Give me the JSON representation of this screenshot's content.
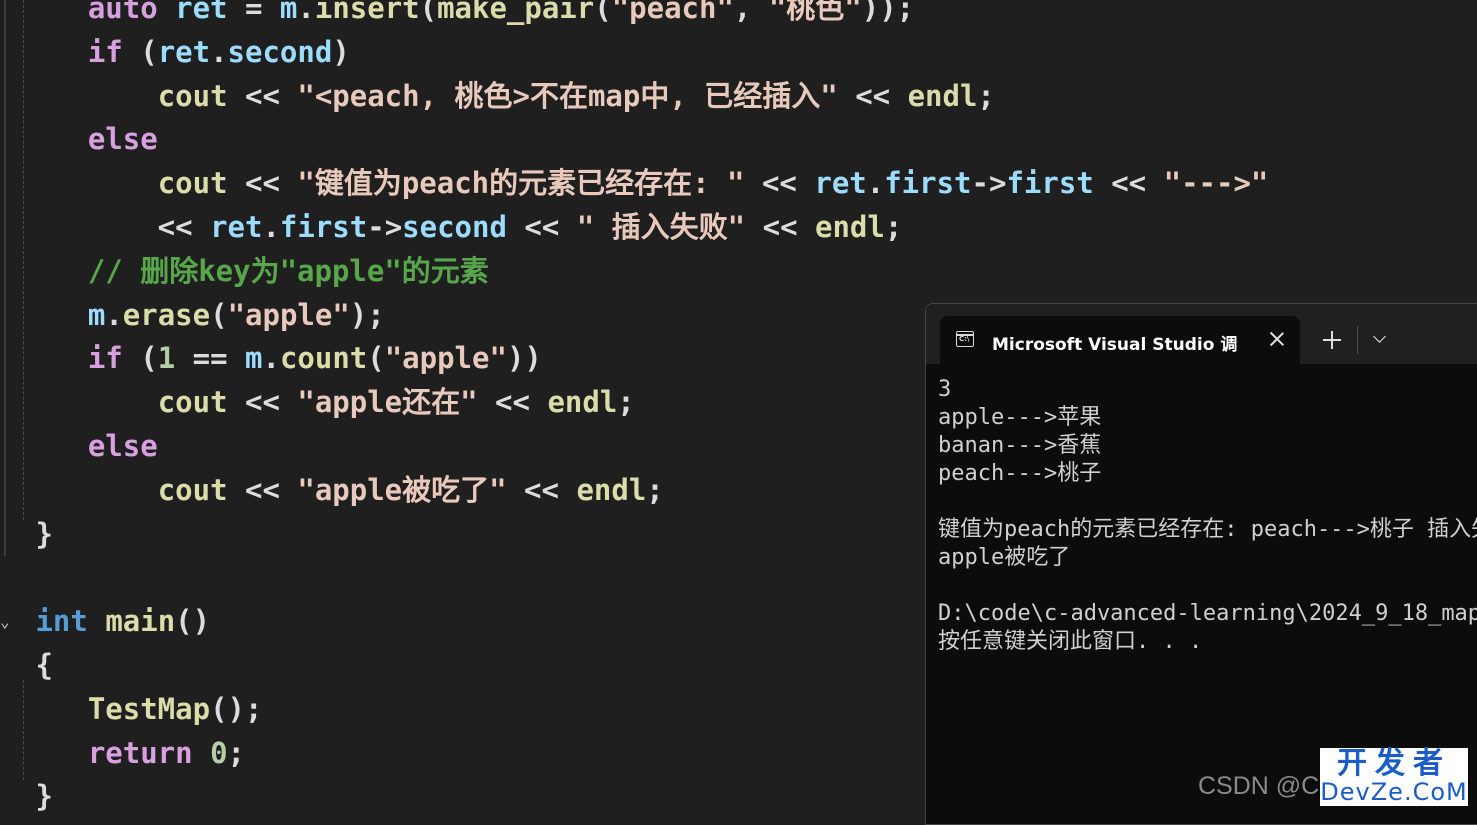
{
  "editor": {
    "lines": [
      [
        {
          "c": "t-ctl",
          "t": "    auto "
        },
        {
          "c": "t-var",
          "t": "ret"
        },
        {
          "c": "t-pl",
          "t": " = "
        },
        {
          "c": "t-var",
          "t": "m"
        },
        {
          "c": "t-pl",
          "t": "."
        },
        {
          "c": "t-fn",
          "t": "insert"
        },
        {
          "c": "t-pl",
          "t": "("
        },
        {
          "c": "t-fn",
          "t": "make_pair"
        },
        {
          "c": "t-pl",
          "t": "("
        },
        {
          "c": "t-str",
          "t": "\"peach\""
        },
        {
          "c": "t-pl",
          "t": ", "
        },
        {
          "c": "t-str",
          "t": "\"桃色\""
        },
        {
          "c": "t-pl",
          "t": "));"
        }
      ],
      [
        {
          "c": "t-ctl",
          "t": "    if"
        },
        {
          "c": "t-pl",
          "t": " ("
        },
        {
          "c": "t-var",
          "t": "ret"
        },
        {
          "c": "t-pl",
          "t": "."
        },
        {
          "c": "t-var",
          "t": "second"
        },
        {
          "c": "t-pl",
          "t": ")"
        }
      ],
      [
        {
          "c": "t-pl",
          "t": "        "
        },
        {
          "c": "t-fn",
          "t": "cout"
        },
        {
          "c": "t-pl",
          "t": " << "
        },
        {
          "c": "t-str",
          "t": "\"<peach, 桃色>不在map中, 已经插入\""
        },
        {
          "c": "t-pl",
          "t": " << "
        },
        {
          "c": "t-fn",
          "t": "endl"
        },
        {
          "c": "t-pl",
          "t": ";"
        }
      ],
      [
        {
          "c": "t-ctl",
          "t": "    else"
        }
      ],
      [
        {
          "c": "t-pl",
          "t": "        "
        },
        {
          "c": "t-fn",
          "t": "cout"
        },
        {
          "c": "t-pl",
          "t": " << "
        },
        {
          "c": "t-str",
          "t": "\"键值为peach的元素已经存在: \""
        },
        {
          "c": "t-pl",
          "t": " << "
        },
        {
          "c": "t-var",
          "t": "ret"
        },
        {
          "c": "t-pl",
          "t": "."
        },
        {
          "c": "t-var",
          "t": "first"
        },
        {
          "c": "t-pl",
          "t": "->"
        },
        {
          "c": "t-var",
          "t": "first"
        },
        {
          "c": "t-pl",
          "t": " << "
        },
        {
          "c": "t-str",
          "t": "\"--->\""
        }
      ],
      [
        {
          "c": "t-pl",
          "t": "        << "
        },
        {
          "c": "t-var",
          "t": "ret"
        },
        {
          "c": "t-pl",
          "t": "."
        },
        {
          "c": "t-var",
          "t": "first"
        },
        {
          "c": "t-pl",
          "t": "->"
        },
        {
          "c": "t-var",
          "t": "second"
        },
        {
          "c": "t-pl",
          "t": " << "
        },
        {
          "c": "t-str",
          "t": "\" 插入失败\""
        },
        {
          "c": "t-pl",
          "t": " << "
        },
        {
          "c": "t-fn",
          "t": "endl"
        },
        {
          "c": "t-pl",
          "t": ";"
        }
      ],
      [
        {
          "c": "t-cm",
          "t": "    // 删除key为\"apple\"的元素"
        }
      ],
      [
        {
          "c": "t-pl",
          "t": "    "
        },
        {
          "c": "t-var",
          "t": "m"
        },
        {
          "c": "t-pl",
          "t": "."
        },
        {
          "c": "t-fn",
          "t": "erase"
        },
        {
          "c": "t-pl",
          "t": "("
        },
        {
          "c": "t-str",
          "t": "\"apple\""
        },
        {
          "c": "t-pl",
          "t": ");"
        }
      ],
      [
        {
          "c": "t-ctl",
          "t": "    if"
        },
        {
          "c": "t-pl",
          "t": " ("
        },
        {
          "c": "t-num",
          "t": "1"
        },
        {
          "c": "t-pl",
          "t": " == "
        },
        {
          "c": "t-var",
          "t": "m"
        },
        {
          "c": "t-pl",
          "t": "."
        },
        {
          "c": "t-fn",
          "t": "count"
        },
        {
          "c": "t-pl",
          "t": "("
        },
        {
          "c": "t-str",
          "t": "\"apple\""
        },
        {
          "c": "t-pl",
          "t": "))"
        }
      ],
      [
        {
          "c": "t-pl",
          "t": "        "
        },
        {
          "c": "t-fn",
          "t": "cout"
        },
        {
          "c": "t-pl",
          "t": " << "
        },
        {
          "c": "t-str",
          "t": "\"apple还在\""
        },
        {
          "c": "t-pl",
          "t": " << "
        },
        {
          "c": "t-fn",
          "t": "endl"
        },
        {
          "c": "t-pl",
          "t": ";"
        }
      ],
      [
        {
          "c": "t-ctl",
          "t": "    else"
        }
      ],
      [
        {
          "c": "t-pl",
          "t": "        "
        },
        {
          "c": "t-fn",
          "t": "cout"
        },
        {
          "c": "t-pl",
          "t": " << "
        },
        {
          "c": "t-str",
          "t": "\"apple被吃了\""
        },
        {
          "c": "t-pl",
          "t": " << "
        },
        {
          "c": "t-fn",
          "t": "endl"
        },
        {
          "c": "t-pl",
          "t": ";"
        }
      ],
      [
        {
          "c": "t-pl",
          "t": " }"
        }
      ],
      [
        {
          "c": "t-pl",
          "t": ""
        }
      ],
      [
        {
          "c": "t-kw",
          "t": " int"
        },
        {
          "c": "t-pl",
          "t": " "
        },
        {
          "c": "t-fn",
          "t": "main"
        },
        {
          "c": "t-pl",
          "t": "()"
        }
      ],
      [
        {
          "c": "t-pl",
          "t": " {"
        }
      ],
      [
        {
          "c": "t-pl",
          "t": "    "
        },
        {
          "c": "t-fn",
          "t": "TestMap"
        },
        {
          "c": "t-pl",
          "t": "();"
        }
      ],
      [
        {
          "c": "t-ctl",
          "t": "    return"
        },
        {
          "c": "t-pl",
          "t": " "
        },
        {
          "c": "t-num",
          "t": "0"
        },
        {
          "c": "t-pl",
          "t": ";"
        }
      ],
      [
        {
          "c": "t-pl",
          "t": " }"
        }
      ]
    ],
    "fold_icon": "chevron-down-icon",
    "fold_glyph": "⌄"
  },
  "terminal": {
    "tab_title": "Microsoft Visual Studio 调试控制台",
    "tab_icon": "console-icon",
    "output": [
      "3",
      "apple--->苹果",
      "banan--->香蕉",
      "peach--->桃子",
      "",
      "键值为peach的元素已经存在: peach--->桃子 插入失败",
      "apple被吃了",
      "",
      "D:\\code\\c-advanced-learning\\2024_9_18_map",
      "按任意键关闭此窗口. . ."
    ]
  },
  "watermark": {
    "csdn": "CSDN @C",
    "devze_line1": "开发者",
    "devze_line2": "DevZe.CoM"
  }
}
